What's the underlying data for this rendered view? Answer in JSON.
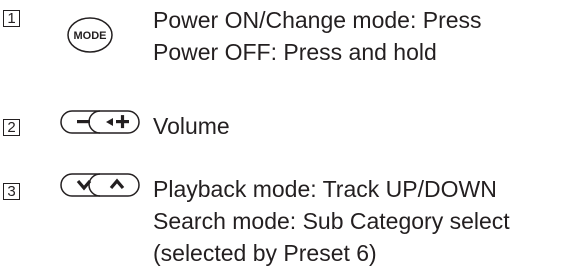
{
  "items": [
    {
      "number": "1",
      "icon": "mode-button-icon",
      "icon_label": "MODE",
      "lines": [
        "Power ON/Change mode: Press",
        "Power OFF: Press and hold"
      ]
    },
    {
      "number": "2",
      "icon": "volume-minus-plus-icon",
      "icon_label": "",
      "lines": [
        "Volume"
      ]
    },
    {
      "number": "3",
      "icon": "down-up-chevron-icon",
      "icon_label": "",
      "lines": [
        "Playback mode: Track UP/DOWN",
        "Search mode: Sub Category select",
        "(selected by Preset 6)"
      ]
    }
  ]
}
